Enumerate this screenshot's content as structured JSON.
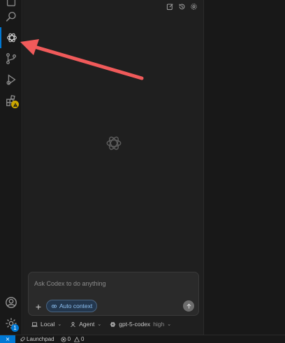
{
  "activity_bar": {
    "icons": [
      "explorer-icon",
      "search-icon",
      "codex-icon",
      "source-control-icon",
      "run-debug-icon",
      "extensions-icon",
      "account-icon",
      "settings-gear-icon"
    ],
    "settings_badge": "1"
  },
  "panel": {
    "toolbar": [
      "new-chat-icon",
      "history-icon",
      "settings-icon"
    ],
    "composer": {
      "placeholder": "Ask Codex to do anything",
      "context_chip": "Auto context"
    },
    "bottom_bar": {
      "environment": "Local",
      "mode": "Agent",
      "model": "gpt-5-codex",
      "reasoning": "high"
    }
  },
  "status_bar": {
    "remote_icon": "remote-icon",
    "launchpad": "Launchpad",
    "errors": "0",
    "warnings": "0"
  },
  "colors": {
    "accent": "#0078d4",
    "annotation_arrow": "#f05a5a",
    "chip": "#8ec1f2"
  }
}
